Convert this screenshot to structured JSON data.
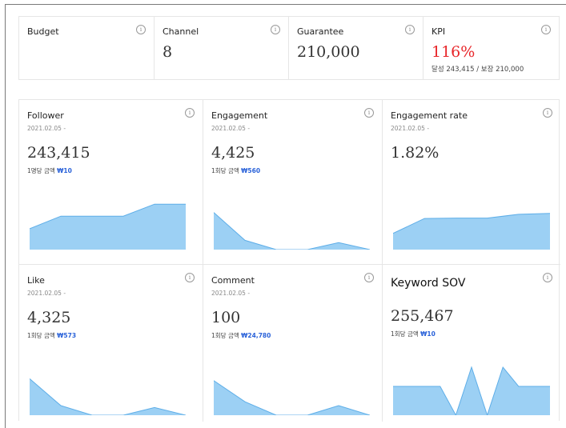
{
  "summary": {
    "budget": {
      "label": "Budget"
    },
    "channel": {
      "label": "Channel",
      "value": "8"
    },
    "guarantee": {
      "label": "Guarantee",
      "value": "210,000"
    },
    "kpi": {
      "label": "KPI",
      "value": "116%",
      "sub": "달성 243,415 / 보장 210,000",
      "value_color": "#e8262a"
    }
  },
  "cards": [
    {
      "title": "Follower",
      "date": "2021.02.05 -",
      "value": "243,415",
      "unit_label": "1명당 금액",
      "unit_amount": "₩10",
      "trend": [
        0.45,
        0.72,
        0.72,
        0.72,
        0.98,
        0.98
      ]
    },
    {
      "title": "Engagement",
      "date": "2021.02.05 -",
      "value": "4,425",
      "unit_label": "1회당 금액",
      "unit_amount": "₩560",
      "trend": [
        0.8,
        0.2,
        0.0,
        0.0,
        0.15,
        0.0
      ]
    },
    {
      "title": "Engagement rate",
      "date": "2021.02.05 -",
      "value": "1.82%",
      "unit_label": "",
      "unit_amount": "",
      "trend": [
        0.35,
        0.67,
        0.68,
        0.68,
        0.76,
        0.78
      ]
    },
    {
      "title": "Like",
      "date": "2021.02.05 -",
      "value": "4,325",
      "unit_label": "1회당 금액",
      "unit_amount": "₩573",
      "trend": [
        0.95,
        0.25,
        0.0,
        0.0,
        0.2,
        0.0
      ]
    },
    {
      "title": "Comment",
      "date": "2021.02.05 -",
      "value": "100",
      "unit_label": "1회당 금액",
      "unit_amount": "₩24,780",
      "trend": [
        0.9,
        0.35,
        0.0,
        0.0,
        0.25,
        0.0
      ]
    },
    {
      "title": "Keyword SOV",
      "date": "",
      "value": "255,467",
      "unit_label": "1회당 금액",
      "unit_amount": "₩10",
      "trend": [
        0.6,
        0.6,
        0.6,
        0.6,
        0.0,
        1.0,
        0.0,
        1.0,
        0.6,
        0.6,
        0.6
      ]
    }
  ],
  "colors": {
    "accent": "#2a62d9",
    "spark_fill": "#9cd0f4",
    "spark_line": "#5eaee8",
    "kpi": "#e8262a"
  },
  "icons": {
    "info": "info-circle-icon"
  }
}
